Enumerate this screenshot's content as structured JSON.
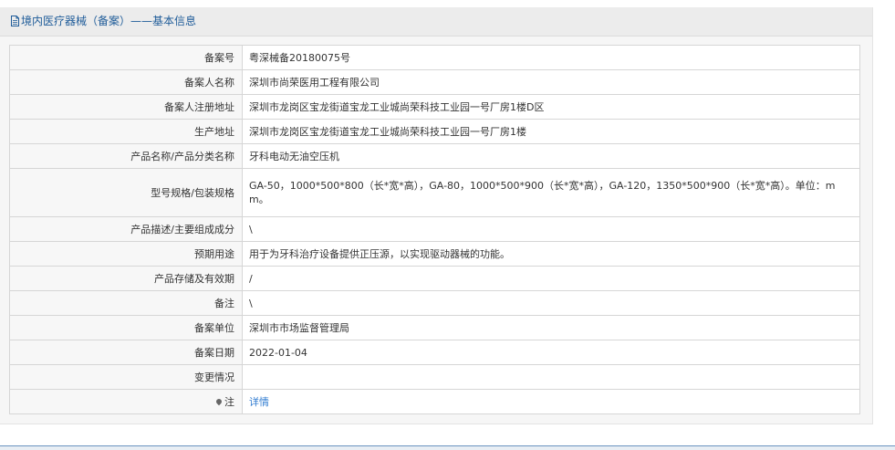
{
  "panel": {
    "title": "境内医疗器械（备案）——基本信息"
  },
  "rows": [
    {
      "label": "备案号",
      "value": "粤深械备20180075号"
    },
    {
      "label": "备案人名称",
      "value": "深圳市尚荣医用工程有限公司"
    },
    {
      "label": "备案人注册地址",
      "value": "深圳市龙岗区宝龙街道宝龙工业城尚荣科技工业园一号厂房1楼D区"
    },
    {
      "label": "生产地址",
      "value": "深圳市龙岗区宝龙街道宝龙工业城尚荣科技工业园一号厂房1楼"
    },
    {
      "label": "产品名称/产品分类名称",
      "value": "牙科电动无油空压机"
    },
    {
      "label": "型号规格/包装规格",
      "value": "GA-50，1000*500*800（长*宽*高），GA-80，1000*500*900（长*宽*高），GA-120，1350*500*900（长*宽*高）。单位：mm。"
    },
    {
      "label": "产品描述/主要组成成分",
      "value": "\\"
    },
    {
      "label": "预期用途",
      "value": "用于为牙科治疗设备提供正压源，以实现驱动器械的功能。"
    },
    {
      "label": "产品存储及有效期",
      "value": "/"
    },
    {
      "label": "备注",
      "value": "\\"
    },
    {
      "label": "备案单位",
      "value": "深圳市市场监督管理局"
    },
    {
      "label": "备案日期",
      "value": "2022-01-04"
    },
    {
      "label": "变更情况",
      "value": ""
    },
    {
      "label": "注",
      "value": "详情"
    }
  ],
  "icons": {
    "title_icon": "document-icon",
    "note_icon": "pin-icon"
  },
  "colors": {
    "title": "#1f5c99",
    "link": "#2f7bd0"
  }
}
